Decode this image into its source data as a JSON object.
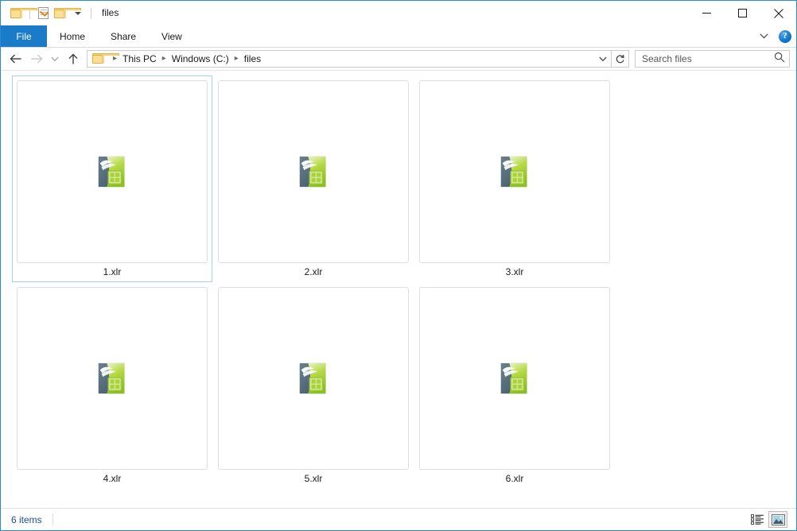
{
  "window": {
    "title": "files",
    "quick_access": [
      {
        "name": "folder-icon",
        "label": "Folder"
      },
      {
        "name": "properties-icon",
        "label": "Properties"
      },
      {
        "name": "new-folder-icon",
        "label": "New folder"
      },
      {
        "name": "customize-caret-icon",
        "label": "Customize Quick Access Toolbar"
      }
    ],
    "controls": {
      "minimize": "Minimize",
      "maximize": "Maximize",
      "close": "Close"
    }
  },
  "ribbon": {
    "tabs": [
      {
        "label": "File",
        "active": true
      },
      {
        "label": "Home",
        "active": false
      },
      {
        "label": "Share",
        "active": false
      },
      {
        "label": "View",
        "active": false
      }
    ],
    "expand_label": "Expand the Ribbon",
    "help_label": "?"
  },
  "navigation": {
    "back": "Back",
    "forward": "Forward",
    "recent": "Recent locations",
    "up": "Up",
    "breadcrumbs": [
      {
        "label": "This PC"
      },
      {
        "label": "Windows (C:)"
      },
      {
        "label": "files"
      }
    ],
    "dropdown_label": "Previous locations",
    "refresh_label": "Refresh"
  },
  "search": {
    "placeholder": "Search files",
    "value": "",
    "icon": "search-icon"
  },
  "files": [
    {
      "name": "1.xlr",
      "icon": "libreoffice-calc-icon",
      "selected": true
    },
    {
      "name": "2.xlr",
      "icon": "libreoffice-calc-icon",
      "selected": false
    },
    {
      "name": "3.xlr",
      "icon": "libreoffice-calc-icon",
      "selected": false
    },
    {
      "name": "4.xlr",
      "icon": "libreoffice-calc-icon",
      "selected": false
    },
    {
      "name": "5.xlr",
      "icon": "libreoffice-calc-icon",
      "selected": false
    },
    {
      "name": "6.xlr",
      "icon": "libreoffice-calc-icon",
      "selected": false
    }
  ],
  "status": {
    "item_count": "6 items",
    "views": [
      {
        "name": "details-view-button",
        "label": "Details view",
        "active": false
      },
      {
        "name": "large-icons-view-button",
        "label": "Large icons view",
        "active": true
      }
    ]
  },
  "colors": {
    "accent": "#1a7bc9",
    "window_border": "#2b88d8",
    "selection_border": "#9fd3ef",
    "status_text": "#1d4f91",
    "thumb_border": "#dedede"
  }
}
